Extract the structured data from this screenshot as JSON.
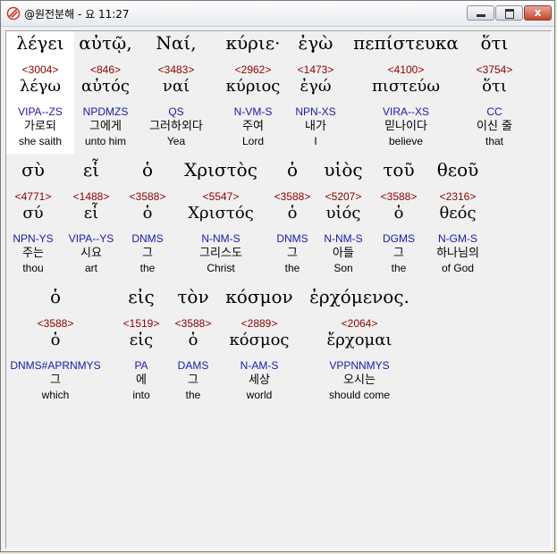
{
  "window": {
    "title": "@원전분해 - 요 11:27",
    "close_glyph": "x"
  },
  "words": [
    {
      "greek": "λέγει",
      "strong": "<3004>",
      "lemma": "λέγω",
      "parse": "VIPA--ZS",
      "korean": "가로되",
      "english": "she saith"
    },
    {
      "greek": "αὐτῷ,",
      "strong": "<846>",
      "lemma": "αὐτός",
      "parse": "NPDMZS",
      "korean": "그에게",
      "english": "unto him"
    },
    {
      "greek": "Ναί,",
      "strong": "<3483>",
      "lemma": "ναί",
      "parse": "QS",
      "korean": "그러하외다",
      "english": "Yea"
    },
    {
      "greek": "κύριε·",
      "strong": "<2962>",
      "lemma": "κύριος",
      "parse": "N-VM-S",
      "korean": "주여",
      "english": "Lord"
    },
    {
      "greek": "ἐγὼ",
      "strong": "<1473>",
      "lemma": "ἐγώ",
      "parse": "NPN-XS",
      "korean": "내가",
      "english": "I"
    },
    {
      "greek": "πεπίστευκα",
      "strong": "<4100>",
      "lemma": "πιστεύω",
      "parse": "VIRA--XS",
      "korean": "믿나이다",
      "english": "believe"
    },
    {
      "greek": "ὅτι",
      "strong": "<3754>",
      "lemma": "ὅτι",
      "parse": "CC",
      "korean": "이신 줄",
      "english": "that"
    },
    {
      "greek": "σὺ",
      "strong": "<4771>",
      "lemma": "σύ",
      "parse": "NPN-YS",
      "korean": "주는",
      "english": "thou"
    },
    {
      "greek": "εἶ",
      "strong": "<1488>",
      "lemma": "εἶ",
      "parse": "VIPA--YS",
      "korean": "시요",
      "english": "art"
    },
    {
      "greek": "ὁ",
      "strong": "<3588>",
      "lemma": "ὁ",
      "parse": "DNMS",
      "korean": "그",
      "english": "the"
    },
    {
      "greek": "Χριστὸς",
      "strong": "<5547>",
      "lemma": "Χριστός",
      "parse": "N-NM-S",
      "korean": "그리스도",
      "english": "Christ"
    },
    {
      "greek": "ὁ",
      "strong": "<3588>",
      "lemma": "ὁ",
      "parse": "DNMS",
      "korean": "그",
      "english": "the"
    },
    {
      "greek": "υἱὸς",
      "strong": "<5207>",
      "lemma": "υἱός",
      "parse": "N-NM-S",
      "korean": "아들",
      "english": "Son"
    },
    {
      "greek": "τοῦ",
      "strong": "<3588>",
      "lemma": "ὁ",
      "parse": "DGMS",
      "korean": "그",
      "english": "the"
    },
    {
      "greek": "θεοῦ",
      "strong": "<2316>",
      "lemma": "θεός",
      "parse": "N-GM-S",
      "korean": "하나님의",
      "english": "of God"
    },
    {
      "greek": "ὁ",
      "strong": "<3588>",
      "lemma": "ὁ",
      "parse": "DNMS#APRNMYS",
      "korean": "그",
      "english": "which"
    },
    {
      "greek": "εἰς",
      "strong": "<1519>",
      "lemma": "εἰς",
      "parse": "PA",
      "korean": "에",
      "english": "into"
    },
    {
      "greek": "τὸν",
      "strong": "<3588>",
      "lemma": "ὁ",
      "parse": "DAMS",
      "korean": "그",
      "english": "the"
    },
    {
      "greek": "κόσμον",
      "strong": "<2889>",
      "lemma": "κόσμος",
      "parse": "N-AM-S",
      "korean": "세상",
      "english": "world"
    },
    {
      "greek": "ἐρχόμενος.",
      "strong": "<2064>",
      "lemma": "ἔρχομαι",
      "parse": "VPPNNMYS",
      "korean": "오시는",
      "english": "should come"
    }
  ]
}
